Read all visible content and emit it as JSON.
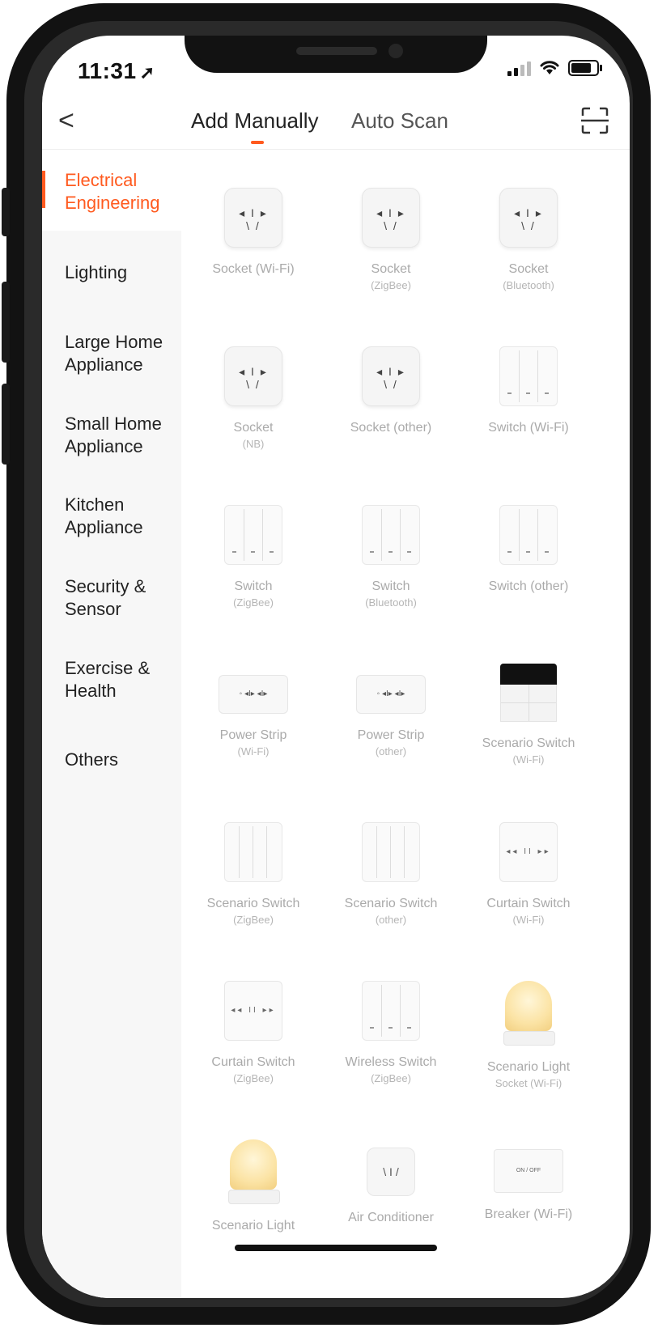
{
  "status_bar": {
    "time": "11:31",
    "location_glyph": "➚"
  },
  "header": {
    "back_glyph": "<",
    "tabs": [
      {
        "label": "Add Manually",
        "active": true
      },
      {
        "label": "Auto Scan",
        "active": false
      }
    ],
    "accent_color": "#ff5a1f"
  },
  "sidebar": {
    "items": [
      {
        "label": "Electrical Engineering",
        "active": true
      },
      {
        "label": "Lighting"
      },
      {
        "label": "Large Home Appliance"
      },
      {
        "label": "Small Home Appliance"
      },
      {
        "label": "Kitchen Appliance"
      },
      {
        "label": "Security & Sensor"
      },
      {
        "label": "Exercise & Health"
      },
      {
        "label": "Others"
      }
    ]
  },
  "devices": [
    {
      "line1": "Socket (Wi-Fi)",
      "line2": "",
      "icon": "socket-icon"
    },
    {
      "line1": "Socket",
      "line2": "(ZigBee)",
      "icon": "socket-icon"
    },
    {
      "line1": "Socket",
      "line2": "(Bluetooth)",
      "icon": "socket-icon"
    },
    {
      "line1": "Socket",
      "line2": "(NB)",
      "icon": "socket-icon"
    },
    {
      "line1": "Socket (other)",
      "line2": "",
      "icon": "socket-icon"
    },
    {
      "line1": "Switch (Wi-Fi)",
      "line2": "",
      "icon": "wall-switch-icon"
    },
    {
      "line1": "Switch",
      "line2": "(ZigBee)",
      "icon": "wall-switch-icon"
    },
    {
      "line1": "Switch",
      "line2": "(Bluetooth)",
      "icon": "wall-switch-icon"
    },
    {
      "line1": "Switch (other)",
      "line2": "",
      "icon": "wall-switch-icon"
    },
    {
      "line1": "Power Strip",
      "line2": "(Wi-Fi)",
      "icon": "power-strip-icon"
    },
    {
      "line1": "Power Strip",
      "line2": "(other)",
      "icon": "power-strip-icon"
    },
    {
      "line1": "Scenario Switch",
      "line2": "(Wi-Fi)",
      "icon": "scenario-switch-icon"
    },
    {
      "line1": "Scenario Switch",
      "line2": "(ZigBee)",
      "icon": "scenario-panel-icon"
    },
    {
      "line1": "Scenario Switch",
      "line2": "(other)",
      "icon": "scenario-panel-icon"
    },
    {
      "line1": "Curtain Switch",
      "line2": "(Wi-Fi)",
      "icon": "curtain-switch-icon"
    },
    {
      "line1": "Curtain Switch",
      "line2": "(ZigBee)",
      "icon": "curtain-switch-icon"
    },
    {
      "line1": "Wireless Switch",
      "line2": "(ZigBee)",
      "icon": "wall-switch-icon"
    },
    {
      "line1": "Scenario Light",
      "line2": "Socket (Wi-Fi)",
      "icon": "lamp-icon"
    },
    {
      "line1": "Scenario Light",
      "line2": "",
      "icon": "lamp-icon"
    },
    {
      "line1": "Air Conditioner",
      "line2": "",
      "icon": "ac-socket-icon"
    },
    {
      "line1": "Breaker (Wi-Fi)",
      "line2": "",
      "icon": "breaker-icon"
    }
  ],
  "icon_text": {
    "socket_holes": "◂ I ▸\n\\  /",
    "curtain": "◂◂  II  ▸▸",
    "breaker": "ON / OFF",
    "strip": "◦  ⁝⁝ ⁝⁝",
    "ac": "╹\n\\ /"
  }
}
